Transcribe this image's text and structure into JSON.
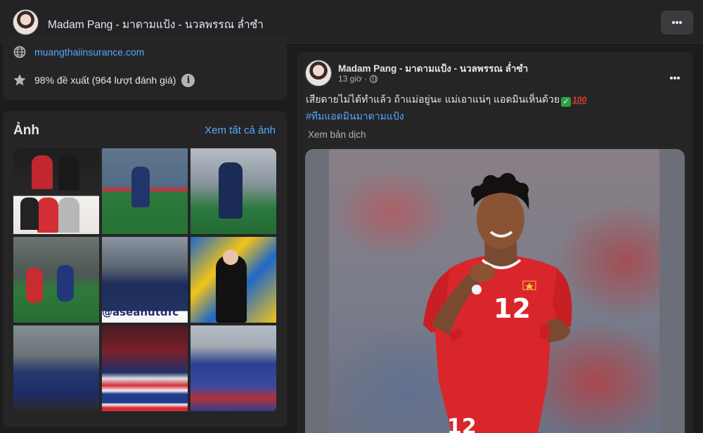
{
  "header": {
    "title": "Madam Pang - มาดามแป้ง - นวลพรรณ ล่ำซำ"
  },
  "intro": {
    "website": "muangthaiinsurance.com",
    "recommendation": "98% đề xuất (964 lượt đánh giá)",
    "info_glyph": "i"
  },
  "photos": {
    "heading": "Ảnh",
    "see_all": "Xem tất cả ảnh",
    "tile5_text": "@aseanutdfc"
  },
  "post": {
    "author": "Madam Pang - มาดามแป้ง - นวลพรรณ ล่ำซำ",
    "time": "13 giờ ·",
    "text": "เสียดายไม่ได้ทำแล้ว ถ้าแม่อยู่นะ แม่เอาแน่ๆ แอดมินเห็นด้วย",
    "check_glyph": "✓",
    "hundred_glyph": "100",
    "hashtag": "#ทีมแอดมินมาดามแป้ง",
    "translate": "Xem bản dịch",
    "image": {
      "jersey_number": "12",
      "shorts_number": "12"
    }
  },
  "icons": {
    "globe": "globe-icon",
    "star": "star-icon",
    "info": "info-icon",
    "more": "more-icon"
  },
  "colors": {
    "background": "#1c1c1d",
    "card": "#252526",
    "link": "#5aa7ff",
    "jersey_red": "#d9262b"
  }
}
